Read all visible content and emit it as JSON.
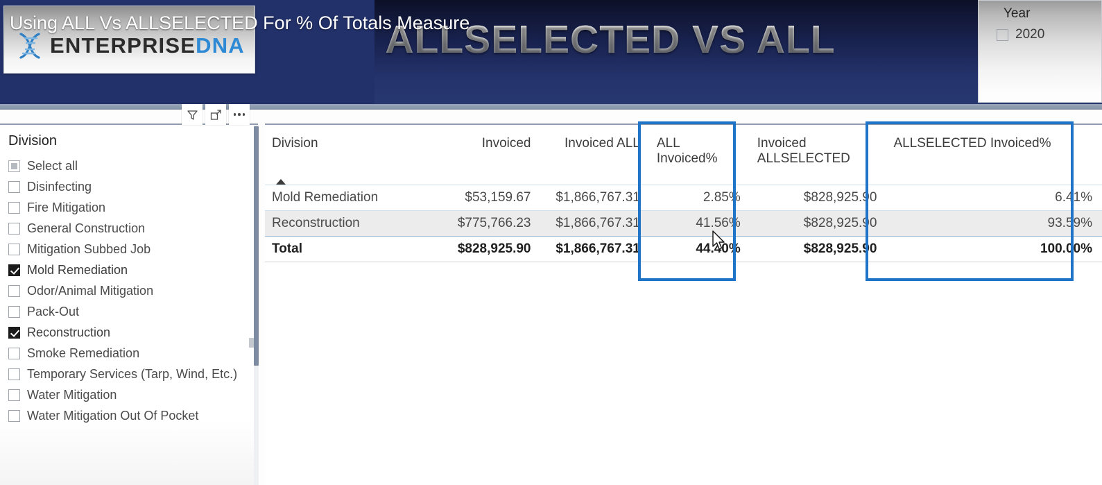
{
  "header": {
    "overlay_caption": "Using ALL Vs ALLSELECTED For % Of Totals Measure",
    "big_title": "ALLSELECTED VS ALL",
    "logo_word_1": "ENTERPRISE",
    "logo_word_2": "DNA",
    "brand_blue": "#2e8ad4",
    "band_navy": "#23316a"
  },
  "year_slicer": {
    "title": "Year",
    "items": [
      {
        "label": "2020",
        "checked": false
      }
    ]
  },
  "toolbar": {
    "filter_label": "Filters",
    "focus_label": "Focus mode",
    "more_label": "More options"
  },
  "division_slicer": {
    "title": "Division",
    "items": [
      {
        "label": "Select all",
        "state": "partial"
      },
      {
        "label": "Disinfecting",
        "state": "unchecked"
      },
      {
        "label": "Fire Mitigation",
        "state": "unchecked"
      },
      {
        "label": "General Construction",
        "state": "unchecked"
      },
      {
        "label": "Mitigation Subbed Job",
        "state": "unchecked"
      },
      {
        "label": "Mold Remediation",
        "state": "checked"
      },
      {
        "label": "Odor/Animal Mitigation",
        "state": "unchecked"
      },
      {
        "label": "Pack-Out",
        "state": "unchecked"
      },
      {
        "label": "Reconstruction",
        "state": "checked"
      },
      {
        "label": "Smoke Remediation",
        "state": "unchecked"
      },
      {
        "label": "Temporary Services (Tarp, Wind, Etc.)",
        "state": "unchecked"
      },
      {
        "label": "Water Mitigation",
        "state": "unchecked"
      },
      {
        "label": "Water Mitigation Out Of Pocket",
        "state": "unchecked"
      }
    ]
  },
  "table": {
    "columns": [
      "Division",
      "Invoiced",
      "Invoiced ALL",
      "ALL Invoiced%",
      "Invoiced ALLSELECTED",
      "ALLSELECTED Invoiced%"
    ],
    "columns_wrapped": [
      [
        "Division"
      ],
      [
        "Invoiced"
      ],
      [
        "Invoiced ALL"
      ],
      [
        "ALL",
        "Invoiced%"
      ],
      [
        "Invoiced",
        "ALLSELECTED"
      ],
      [
        "ALLSELECTED Invoiced%"
      ]
    ],
    "sort_column": "Division",
    "sort_direction": "ascending",
    "rows": [
      {
        "division": "Mold Remediation",
        "invoiced": "$53,159.67",
        "invoiced_all": "$1,866,767.31",
        "all_invoiced_pct": "2.85%",
        "invoiced_allselected": "$828,925.90",
        "allselected_invoiced_pct": "6.41%"
      },
      {
        "division": "Reconstruction",
        "invoiced": "$775,766.23",
        "invoiced_all": "$1,866,767.31",
        "all_invoiced_pct": "41.56%",
        "invoiced_allselected": "$828,925.90",
        "allselected_invoiced_pct": "93.59%"
      }
    ],
    "total": {
      "division": "Total",
      "invoiced": "$828,925.90",
      "invoiced_all": "$1,866,767.31",
      "all_invoiced_pct": "44.40%",
      "invoiced_allselected": "$828,925.90",
      "allselected_invoiced_pct": "100.00%"
    },
    "highlight_color": "#1f74c8",
    "highlighted_columns": [
      "ALL Invoiced%",
      "ALLSELECTED Invoiced%"
    ]
  }
}
